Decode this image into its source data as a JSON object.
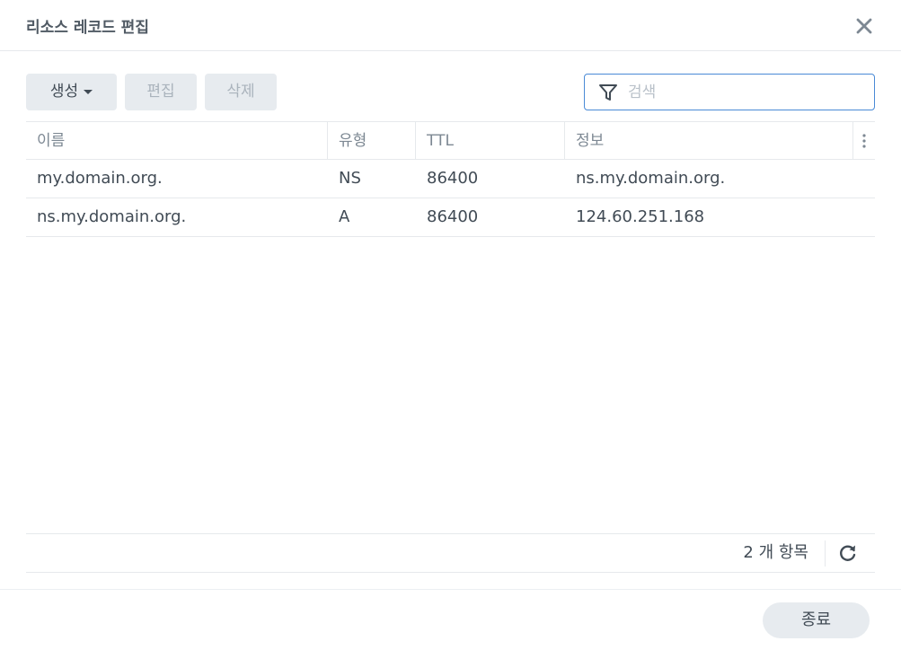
{
  "dialog": {
    "title": "리소스 레코드 편집",
    "close_icon": "close-icon"
  },
  "toolbar": {
    "create_label": "생성",
    "edit_label": "편집",
    "delete_label": "삭제",
    "search_placeholder": "검색",
    "search_value": ""
  },
  "table": {
    "columns": [
      "이름",
      "유형",
      "TTL",
      "정보"
    ],
    "rows": [
      [
        "my.domain.org.",
        "NS",
        "86400",
        "ns.my.domain.org."
      ],
      [
        "ns.my.domain.org.",
        "A",
        "86400",
        "124.60.251.168"
      ]
    ]
  },
  "footer": {
    "count_text": "2 개 항목",
    "close_label": "종료"
  },
  "colors": {
    "accent": "#4a8ad6",
    "button_bg": "#e7ebef",
    "text": "#414b55",
    "header_text": "#7d8893"
  }
}
